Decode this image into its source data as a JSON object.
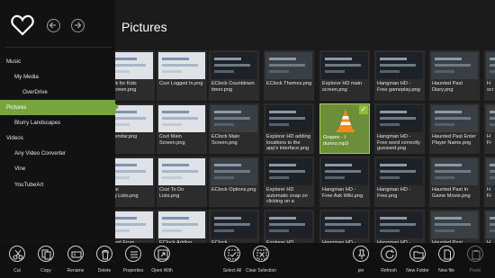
{
  "page": {
    "title": "Pictures"
  },
  "nav": {
    "items": [
      {
        "label": "Music",
        "indent": 0,
        "active": false
      },
      {
        "label": "My Media",
        "indent": 1,
        "active": false
      },
      {
        "label": "OverDrive",
        "indent": 2,
        "active": false
      },
      {
        "label": "Pictures",
        "indent": 0,
        "active": true
      },
      {
        "label": "Blurry Landscapes",
        "indent": 1,
        "active": false
      },
      {
        "label": "Videos",
        "indent": 0,
        "active": false
      },
      {
        "label": "Any Video Converter",
        "indent": 1,
        "active": false
      },
      {
        "label": "Vine",
        "indent": 1,
        "active": false
      },
      {
        "label": "YouTubeArt",
        "indent": 1,
        "active": false
      }
    ],
    "accent_color": "#76a540"
  },
  "files": [
    {
      "name": "book for Kids\ne screen.png",
      "style": "light"
    },
    {
      "name": "Cozi Logged In.png",
      "style": "light"
    },
    {
      "name": "EClock Countdown\ntimer.png",
      "style": "dark"
    },
    {
      "name": "EClock Themes.png",
      "style": "mid"
    },
    {
      "name": "Explorer HD main\nscreen.png",
      "style": "dark"
    },
    {
      "name": "Hangman HD -\nFree gameplay.png",
      "style": "dark"
    },
    {
      "name": "Haunted Past\nDiary.png",
      "style": "mid"
    },
    {
      "name": "H\nscr",
      "style": "mid"
    },
    {
      "name": "Calendar.png",
      "style": "light"
    },
    {
      "name": "Cozi Main\nScreen.png",
      "style": "light"
    },
    {
      "name": "EClock Main\nScreen.png",
      "style": "mid"
    },
    {
      "name": "Explorer HD adding\nlocations to the\napp's interface.png",
      "style": "dark"
    },
    {
      "name": "Grapes - I\ndunno.mp3",
      "style": "vlc",
      "selected": true
    },
    {
      "name": "Hangman HD -\nFree word correctly\nguessed.png",
      "style": "dark"
    },
    {
      "name": "Haunted Past Enter\nPlayer Name.png",
      "style": "mid"
    },
    {
      "name": "H\nFi",
      "style": "mid"
    },
    {
      "name": "reate\nhing Lists.png",
      "style": "light"
    },
    {
      "name": "Cozi To Do\nLists.png",
      "style": "light"
    },
    {
      "name": "EClock Options.png",
      "style": "mid"
    },
    {
      "name": "Explorer HD\nautomatic snap on\nclicking on a",
      "style": "dark"
    },
    {
      "name": "Hangman HD -\nFree Ask Wiki.png",
      "style": "dark"
    },
    {
      "name": "Hangman HD -\nFree.png",
      "style": "dark"
    },
    {
      "name": "Haunted Past In\nGame Movie.png",
      "style": "mid"
    },
    {
      "name": "H\nFi",
      "style": "mid"
    },
    {
      "name": "Import From\nides",
      "style": "light"
    },
    {
      "name": "EClock Adding\nClock via Time",
      "style": "light"
    },
    {
      "name": "EClock\nStopwatch.png",
      "style": "dark"
    },
    {
      "name": "Explorer HD\ncopying and",
      "style": "dark"
    },
    {
      "name": "Hangman HD -\nFree categories",
      "style": "dark"
    },
    {
      "name": "Hangman HD -\nFree word",
      "style": "dark"
    },
    {
      "name": "Haunted Past\nClassic Object",
      "style": "mid"
    },
    {
      "name": "H\nIn",
      "style": "mid"
    }
  ],
  "appbar": {
    "buttons": [
      {
        "label": "Cut",
        "icon": "scissors-icon"
      },
      {
        "label": "Copy",
        "icon": "copy-icon"
      },
      {
        "label": "Rename",
        "icon": "rename-icon"
      },
      {
        "label": "Delete",
        "icon": "trash-icon"
      },
      {
        "label": "Properties",
        "icon": "properties-icon"
      },
      {
        "label": "Open With",
        "icon": "open-with-icon"
      },
      {
        "label": "Select All",
        "icon": "select-all-icon"
      },
      {
        "label": "Clear Selection",
        "icon": "clear-selection-icon"
      },
      {
        "label": "pin",
        "icon": "pin-icon"
      },
      {
        "label": "Refresh",
        "icon": "refresh-icon"
      },
      {
        "label": "New Folder",
        "icon": "new-folder-icon"
      },
      {
        "label": "New file",
        "icon": "new-file-icon"
      },
      {
        "label": "Paste",
        "icon": "paste-icon",
        "disabled": true
      }
    ]
  }
}
